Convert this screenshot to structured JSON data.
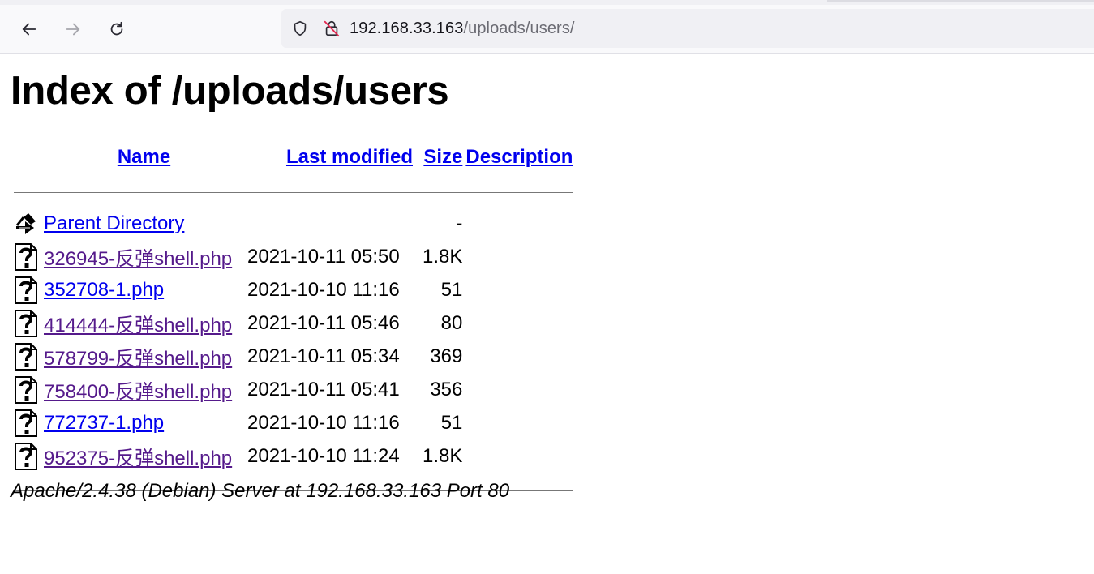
{
  "browser": {
    "url_host": "192.168.33.163",
    "url_path": "/uploads/users/"
  },
  "page": {
    "title": "Index of /uploads/users",
    "columns": {
      "name": "Name",
      "last_modified": "Last modified",
      "size": "Size",
      "description": "Description"
    },
    "parent": {
      "name": "Parent Directory",
      "size": "-"
    },
    "rows": [
      {
        "name": "326945-反弹shell.php",
        "modified": "2021-10-11 05:50",
        "size": "1.8K",
        "visited": true
      },
      {
        "name": "352708-1.php",
        "modified": "2021-10-10 11:16",
        "size": "51",
        "visited": false
      },
      {
        "name": "414444-反弹shell.php",
        "modified": "2021-10-11 05:46",
        "size": "80",
        "visited": true
      },
      {
        "name": "578799-反弹shell.php",
        "modified": "2021-10-11 05:34",
        "size": "369",
        "visited": true
      },
      {
        "name": "758400-反弹shell.php",
        "modified": "2021-10-11 05:41",
        "size": "356",
        "visited": true
      },
      {
        "name": "772737-1.php",
        "modified": "2021-10-10 11:16",
        "size": "51",
        "visited": false
      },
      {
        "name": "952375-反弹shell.php",
        "modified": "2021-10-10 11:24",
        "size": "1.8K",
        "visited": true
      }
    ],
    "footer": "Apache/2.4.38 (Debian) Server at 192.168.33.163 Port 80"
  },
  "colors": {
    "link": "#0000ee",
    "visited_link": "#551a8b"
  }
}
